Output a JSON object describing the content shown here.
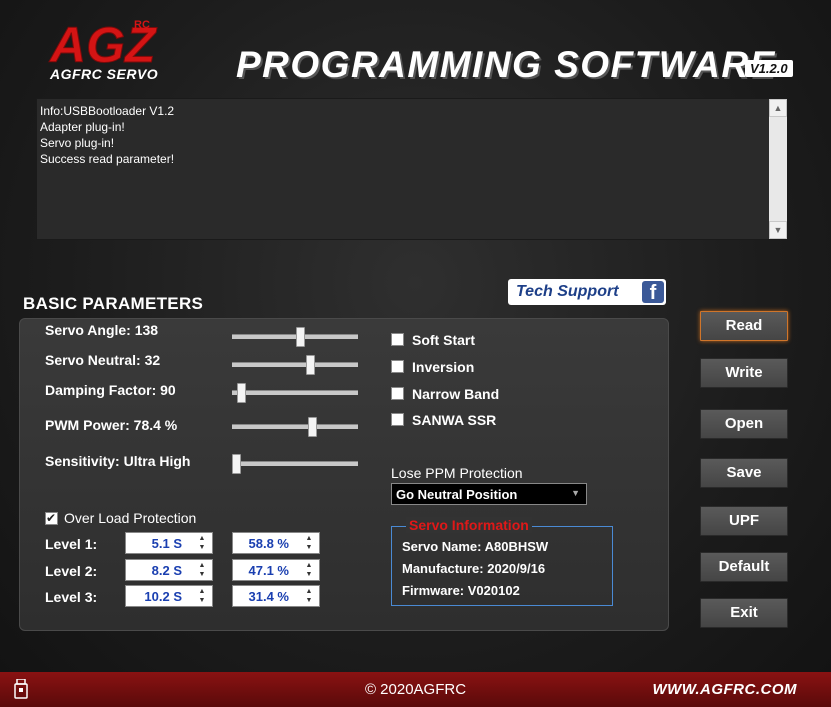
{
  "header": {
    "logo_text": "AGZ",
    "logo_rc": "RC",
    "logo_sub": "AGFRC SERVO",
    "title": "PROGRAMMING SOFTWARE",
    "version": "V1.2.0"
  },
  "log": {
    "lines": [
      "Info:USBBootloader V1.2",
      "Adapter plug-in!",
      "Servo plug-in!",
      "Success read parameter!"
    ]
  },
  "tech_support": {
    "label": "Tech Support",
    "fb": "f"
  },
  "basic": {
    "title": "BASIC PARAMETERS",
    "sliders": [
      {
        "label": "Servo Angle: 138",
        "level": 0.55
      },
      {
        "label": "Servo Neutral: 32",
        "level": 0.63
      },
      {
        "label": "Damping Factor: 90",
        "level": 0.04
      },
      {
        "label": "PWM Power: 78.4 %",
        "level": 0.65
      },
      {
        "label": "Sensitivity: Ultra High",
        "level": 0.0
      }
    ],
    "checkboxes": [
      {
        "label": "Soft Start",
        "checked": false
      },
      {
        "label": "Inversion",
        "checked": false
      },
      {
        "label": "Narrow Band",
        "checked": false
      },
      {
        "label": "SANWA SSR",
        "checked": false
      }
    ],
    "lose_ppm": {
      "label": "Lose PPM Protection",
      "value": "Go Neutral Position"
    },
    "over_load": {
      "label": "Over Load Protection",
      "checked": true
    },
    "levels": [
      {
        "label": "Level 1:",
        "time": "5.1 S",
        "percent": "58.8 %"
      },
      {
        "label": "Level 2:",
        "time": "8.2 S",
        "percent": "47.1 %"
      },
      {
        "label": "Level 3:",
        "time": "10.2 S",
        "percent": "31.4 %"
      }
    ],
    "servo_info": {
      "title": "Servo Information",
      "name": "Servo Name: A80BHSW",
      "manufacture": "Manufacture: 2020/9/16",
      "firmware": "Firmware: V020102"
    }
  },
  "buttons": {
    "read": "Read",
    "write": "Write",
    "open": "Open",
    "save": "Save",
    "upf": "UPF",
    "default": "Default",
    "exit": "Exit"
  },
  "footer": {
    "copyright": "© 2020AGFRC",
    "url": "WWW.AGFRC.COM"
  }
}
